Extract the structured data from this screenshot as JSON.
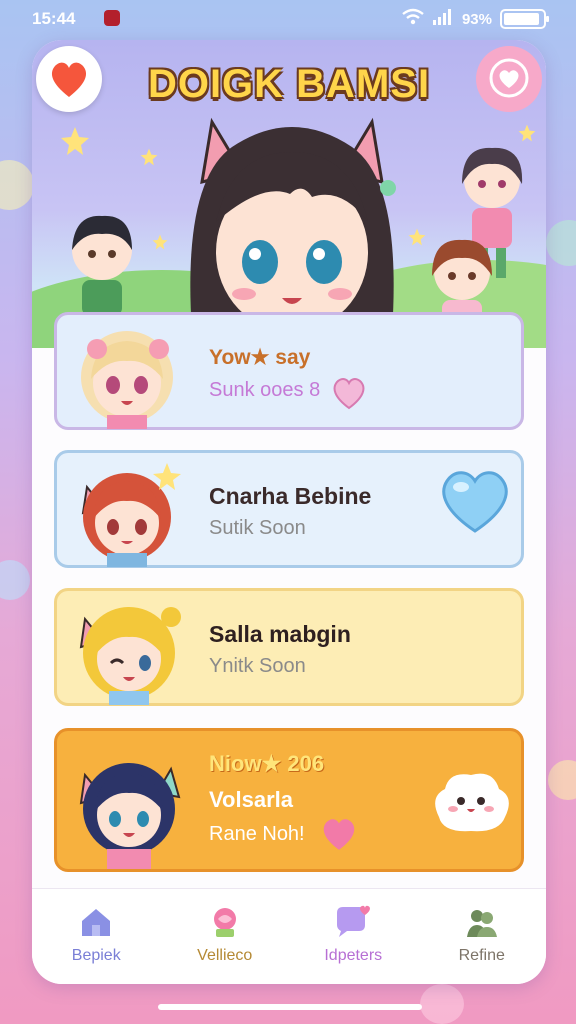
{
  "status_bar": {
    "time": "15:44",
    "battery": "93%",
    "battery_level": 0.93
  },
  "hero": {
    "title": "DOIGK BAMSI"
  },
  "list": [
    {
      "title": "Yow★ say",
      "subtitle": "Sunk ooes 8",
      "theme": {
        "bg": "#e3eefc",
        "border": "#c9b7e6",
        "title_color": "#c8702a",
        "sub_color": "#c57ad6"
      },
      "right_icon": "heart-badge-icon"
    },
    {
      "title": "Cnarha Bebine",
      "subtitle": "Sutik Soon",
      "theme": {
        "bg": "#e6f1fc",
        "border": "#a9cbe9",
        "title_color": "#3a2a2a",
        "sub_color": "#8a8a8a"
      },
      "right_icon": "blue-heart-icon"
    },
    {
      "title": "Salla mabgin",
      "subtitle": "Ynitk Soon",
      "theme": {
        "bg": "#fdedb5",
        "border": "#f2d485",
        "title_color": "#2e2020",
        "sub_color": "#8a8a8a"
      },
      "right_icon": ""
    },
    {
      "badge": "Niow★ 206",
      "title": "Volsarla",
      "subtitle": "Rane Noh!",
      "theme": {
        "bg": "#f7b13e",
        "border": "#e7912a",
        "title_color": "#ffffff",
        "sub_color": "#ffffff"
      },
      "right_icon": "ghost-cloud-icon"
    }
  ],
  "nav": [
    {
      "label": "Bepiek",
      "icon": "home-icon",
      "color": "#7a7fd6"
    },
    {
      "label": "Vellieco",
      "icon": "cake-icon",
      "color": "#b58a35"
    },
    {
      "label": "Idpeters",
      "icon": "chat-bubble-icon",
      "color": "#b76fd4"
    },
    {
      "label": "Refine",
      "icon": "people-icon",
      "color": "#7d7468"
    }
  ]
}
